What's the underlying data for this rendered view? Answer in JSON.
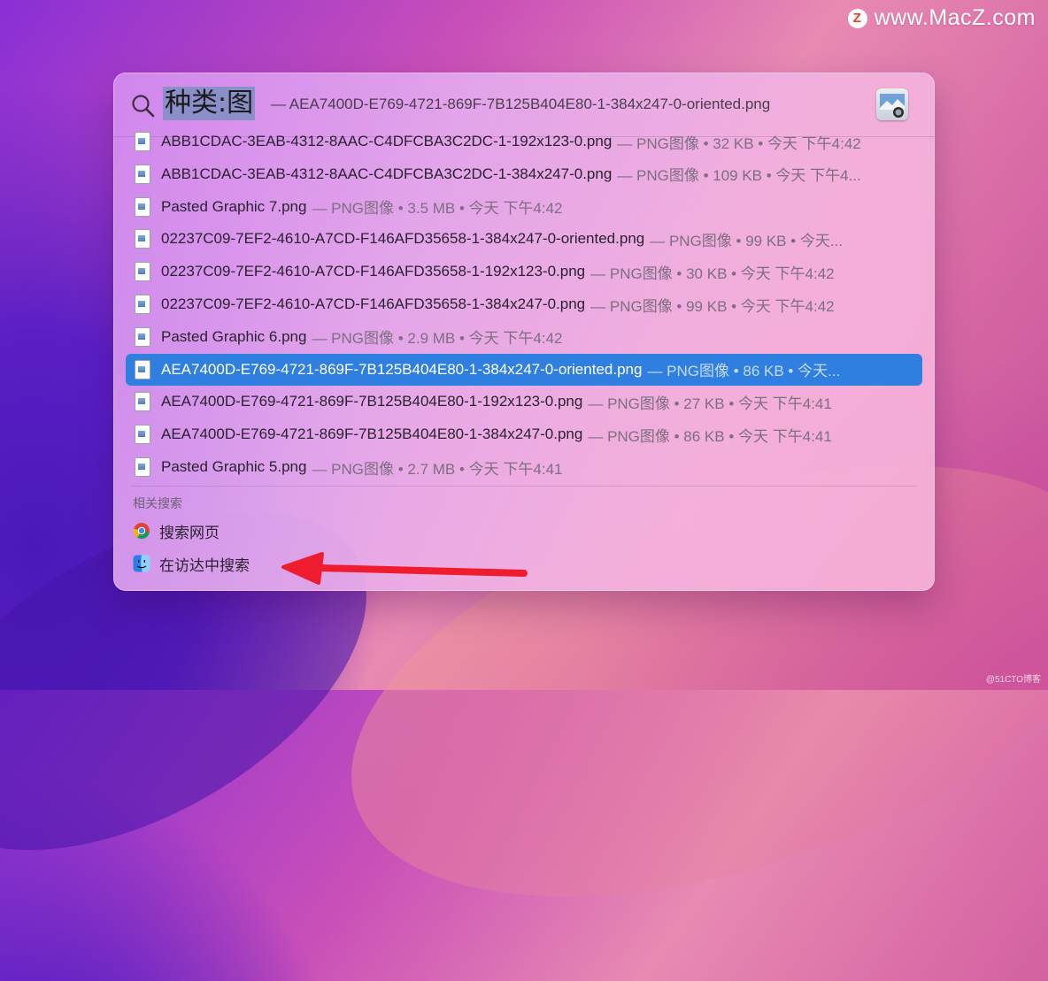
{
  "watermark": {
    "logo_letter": "Z",
    "text": "www.MacZ.com"
  },
  "credit": "@51CTO博客",
  "spotlight": {
    "query": "种类:图",
    "top_hit_hint": "— AEA7400D-E769-4721-869F-7B125B404E80-1-384x247-0-oriented.png",
    "results": [
      {
        "name": "ABB1CDAC-3EAB-4312-8AAC-C4DFCBA3C2DC-1-192x123-0.png",
        "meta": "— PNG图像 • 32 KB • 今天 下午4:42"
      },
      {
        "name": "ABB1CDAC-3EAB-4312-8AAC-C4DFCBA3C2DC-1-384x247-0.png",
        "meta": "— PNG图像 • 109 KB • 今天 下午4..."
      },
      {
        "name": "Pasted Graphic 7.png",
        "meta": "— PNG图像 • 3.5 MB • 今天 下午4:42"
      },
      {
        "name": "02237C09-7EF2-4610-A7CD-F146AFD35658-1-384x247-0-oriented.png",
        "meta": "— PNG图像 • 99 KB • 今天..."
      },
      {
        "name": "02237C09-7EF2-4610-A7CD-F146AFD35658-1-192x123-0.png",
        "meta": "— PNG图像 • 30 KB • 今天 下午4:42"
      },
      {
        "name": "02237C09-7EF2-4610-A7CD-F146AFD35658-1-384x247-0.png",
        "meta": "— PNG图像 • 99 KB • 今天 下午4:42"
      },
      {
        "name": "Pasted Graphic 6.png",
        "meta": "— PNG图像 • 2.9 MB • 今天 下午4:42"
      },
      {
        "name": "AEA7400D-E769-4721-869F-7B125B404E80-1-384x247-0-oriented.png",
        "meta": "— PNG图像 • 86 KB • 今天...",
        "selected": true
      },
      {
        "name": "AEA7400D-E769-4721-869F-7B125B404E80-1-192x123-0.png",
        "meta": "— PNG图像 • 27 KB • 今天 下午4:41"
      },
      {
        "name": "AEA7400D-E769-4721-869F-7B125B404E80-1-384x247-0.png",
        "meta": "— PNG图像 • 86 KB • 今天 下午4:41"
      },
      {
        "name": "Pasted Graphic 5.png",
        "meta": "— PNG图像 • 2.7 MB • 今天 下午4:41"
      }
    ],
    "related_label": "相关搜索",
    "actions": [
      {
        "label": "搜索网页",
        "icon": "chrome-icon"
      },
      {
        "label": "在访达中搜索",
        "icon": "finder-icon"
      }
    ]
  },
  "colors": {
    "selection": "#2f7fe0",
    "annotation_arrow": "#ee1c2e"
  }
}
